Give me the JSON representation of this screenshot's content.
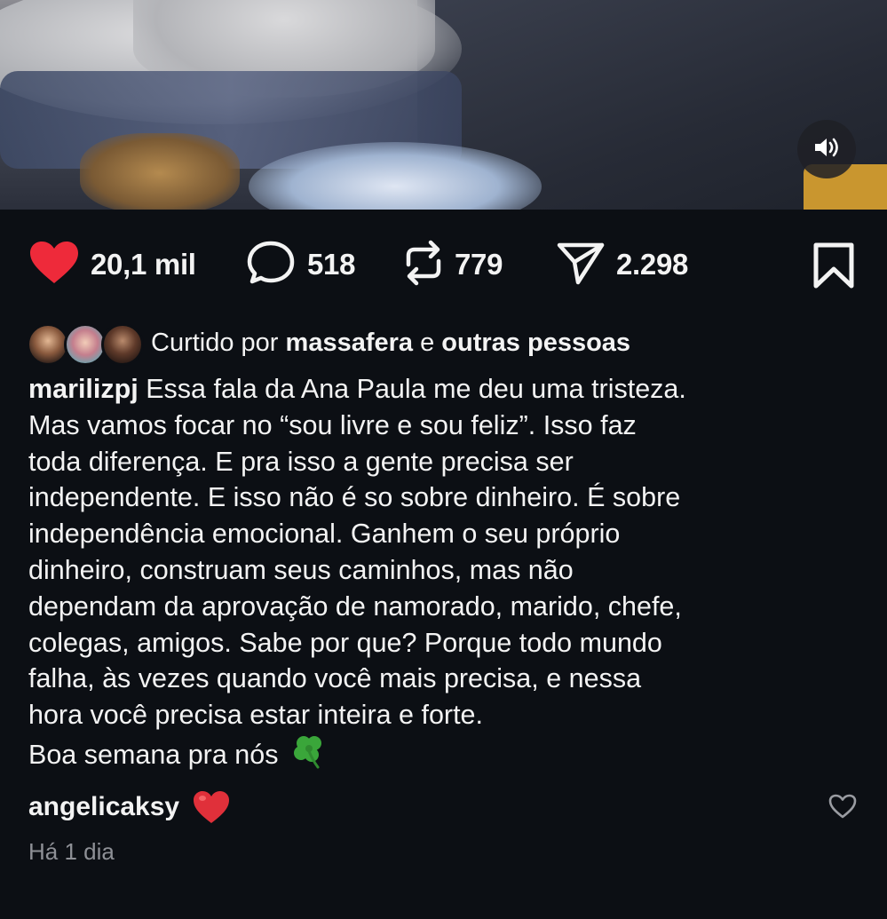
{
  "post": {
    "stats": {
      "likes": "20,1 mil",
      "comments": "518",
      "reposts": "779",
      "shares": "2.298"
    },
    "liked_by": {
      "prefix": "Curtido por",
      "user": "massafera",
      "connector": "e",
      "others": "outras pessoas"
    },
    "caption": {
      "username": "marilizpj",
      "first_line": " Essa fala da Ana Paula me deu uma tristeza.",
      "lines": [
        "Mas vamos focar no “sou livre e sou feliz”. Isso faz",
        "toda diferença. E pra isso a gente precisa ser",
        "independente. E isso não é so sobre dinheiro. É sobre",
        "independência emocional. Ganhem o seu próprio",
        "dinheiro, construam seus caminhos, mas não",
        "dependam da aprovação de namorado, marido, chefe,",
        "colegas, amigos. Sabe por que? Porque todo mundo",
        "falha, às vezes quando você mais precisa, e nessa",
        "hora você precisa estar inteira e forte."
      ],
      "closing": "Boa semana pra nós",
      "closing_emoji": "four-leaf-clover"
    },
    "top_comment": {
      "username": "angelicaksy",
      "emoji": "red-heart"
    },
    "timestamp": "Há 1 dia"
  },
  "colors": {
    "background": "#0c0f14",
    "text": "#f3f3f3",
    "like_red": "#ee2a3a",
    "muted": "#8e9096",
    "clover_green": "#3aa63a"
  },
  "icons": [
    "heart-icon",
    "comment-icon",
    "repost-icon",
    "share-icon",
    "bookmark-icon",
    "volume-icon",
    "comment-like-heart-icon"
  ]
}
